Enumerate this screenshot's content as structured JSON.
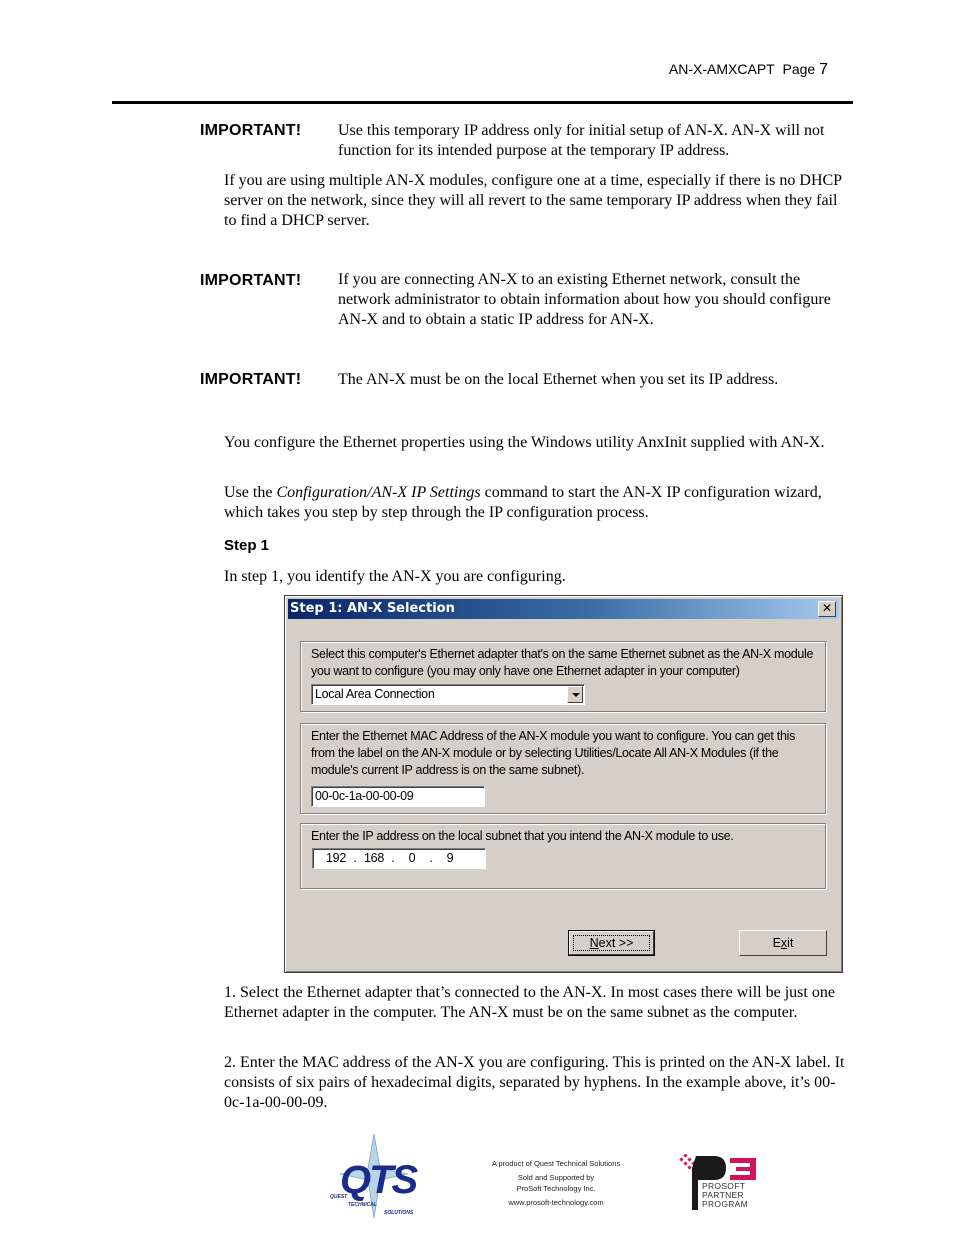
{
  "header": {
    "doc_id": "AN-X-AMXCAPT",
    "page_label": "Page",
    "page_number": "7"
  },
  "notices": [
    {
      "label": "IMPORTANT!",
      "text": "Use this temporary IP address only for initial setup of AN-X.  AN-X will not function for its intended purpose at the temporary IP address."
    },
    {
      "label": "IMPORTANT!",
      "text": "If you are connecting AN-X to an existing Ethernet network, consult the network administrator to obtain information about how you should configure AN-X and to obtain a static IP address for AN-X."
    },
    {
      "label": "IMPORTANT!",
      "text": "The AN-X must be on the local Ethernet when you set its IP address."
    }
  ],
  "paragraphs": {
    "multiple_modules": "If you are using multiple AN-X modules, configure one at a time, especially if there is no DHCP server on the network, since they will all revert to the same temporary IP address when they fail to find a DHCP server.",
    "configure_utility": "You configure the Ethernet properties using the Windows utility AnxInit supplied with AN-X.",
    "use_command_pre": "Use the ",
    "use_command_italic": "Configuration/AN-X IP Settings",
    "use_command_post": " command to start the AN-X IP configuration wizard, which takes you step by step through the IP configuration process.",
    "step_heading": "Step 1",
    "step_intro": "In step 1, you identify the AN-X you are configuring.",
    "item1": "1. Select the Ethernet adapter that’s connected to the AN-X.  In most cases there will be just one Ethernet adapter in the computer.  The AN-X must be on the same subnet as the computer.",
    "item2": "2. Enter the MAC address of the AN-X you are configuring.  This is printed on the AN-X label.  It consists of six pairs of hexadecimal digits, separated by hyphens.  In the example above, it’s 00-0c-1a-00-00-09."
  },
  "dialog": {
    "title": "Step 1: AN-X Selection",
    "close_glyph": "✕",
    "adapter_group_text": "Select this computer's Ethernet adapter that's on the same Ethernet subnet as the AN-X module you want to configure (you may only have one Ethernet adapter in your computer)",
    "adapter_value": "Local Area Connection",
    "mac_group_text": "Enter the Ethernet MAC Address of the AN-X module you want to configure. You can get this from the label on the AN-X module or by selecting Utilities/Locate All AN-X Modules (if the module's current IP address is on the same subnet).",
    "mac_value": "00-0c-1a-00-00-09",
    "ip_group_text": "Enter the IP address on the local subnet that you intend the AN-X module to use.",
    "ip_octets": [
      "192",
      "168",
      "0",
      "9"
    ],
    "ip_separator": ".",
    "next_button": {
      "mnemonic": "N",
      "rest": "ext >>"
    },
    "exit_button": {
      "pre": "E",
      "mnemonic": "x",
      "post": "it"
    }
  },
  "footer": {
    "line1": "A product of Quest Technical Solutions",
    "line2": "Sold and Supported by",
    "line3": "ProSoft Technology Inc.",
    "line4": "www.prosoft-technology.com",
    "qts_logo": {
      "letters": "QTS",
      "sub1": "QUEST",
      "sub2": "TECHNICAL",
      "sub3": "SOLUTIONS",
      "color": "#1a2b8c"
    },
    "p3_logo": {
      "mark": "P3",
      "line1": "PROSOFT",
      "line2": "PARTNER",
      "line3": "PROGRAM",
      "accent": "#d4145a"
    }
  }
}
